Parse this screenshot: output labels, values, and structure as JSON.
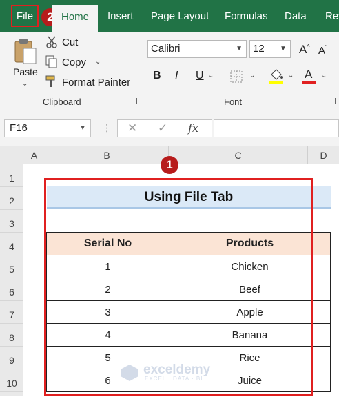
{
  "ribbon_tabs": [
    "File",
    "Home",
    "Insert",
    "Page Layout",
    "Formulas",
    "Data",
    "Rev"
  ],
  "markers": {
    "file": "2",
    "table": "1"
  },
  "clipboard": {
    "paste": "Paste",
    "cut": "Cut",
    "copy": "Copy",
    "format_painter": "Format Painter",
    "group_label": "Clipboard"
  },
  "font": {
    "name": "Calibri",
    "size": "12",
    "bold": "B",
    "italic": "I",
    "underline": "U",
    "grow": "A",
    "shrink": "A",
    "font_color_glyph": "A",
    "group_label": "Font"
  },
  "formula_bar": {
    "name_box": "F16",
    "cancel": "✕",
    "enter": "✓",
    "fx": "fx",
    "content": ""
  },
  "columns": [
    "A",
    "B",
    "C",
    "D"
  ],
  "rows": [
    "1",
    "2",
    "3",
    "4",
    "5",
    "6",
    "7",
    "8",
    "9",
    "10"
  ],
  "sheet": {
    "title": "Using File Tab",
    "headers": [
      "Serial No",
      "Products"
    ],
    "rows": [
      [
        "1",
        "Chicken"
      ],
      [
        "2",
        "Beef"
      ],
      [
        "3",
        "Apple"
      ],
      [
        "4",
        "Banana"
      ],
      [
        "5",
        "Rice"
      ],
      [
        "6",
        "Juice"
      ]
    ]
  },
  "watermark": {
    "name": "exceldemy",
    "tagline": "EXCEL · DATA · BI"
  },
  "colors": {
    "ribbon_green": "#217346",
    "highlight_red": "#e02020",
    "title_fill": "#dbe9f7",
    "header_fill": "#fbe4d5"
  }
}
